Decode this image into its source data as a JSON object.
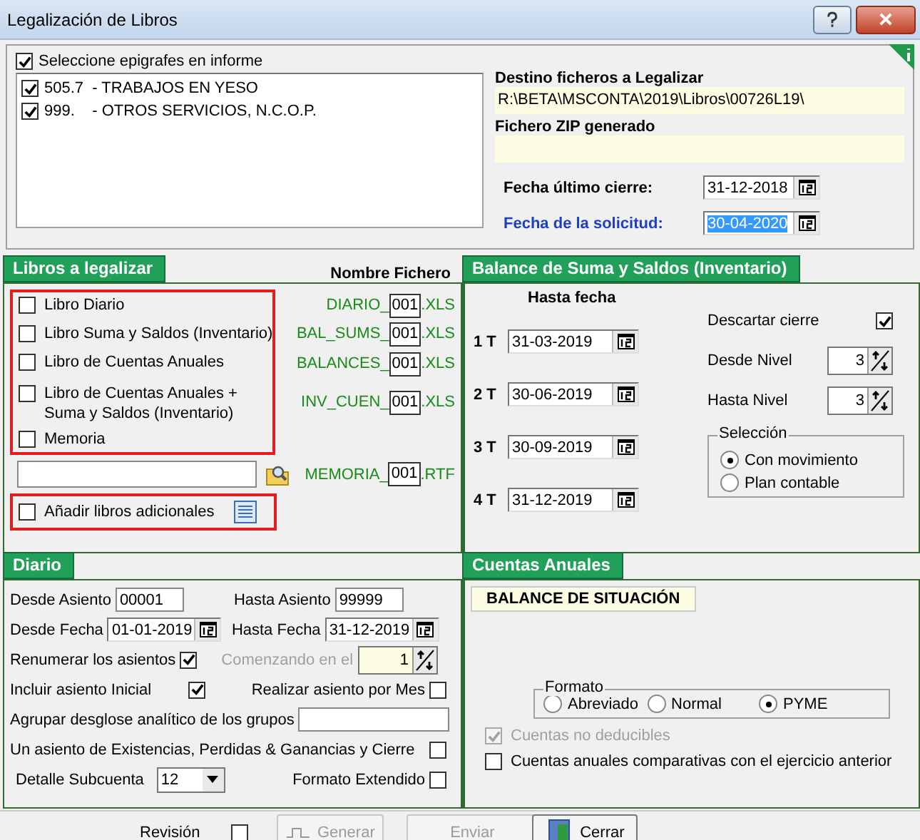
{
  "window": {
    "title": "Legalización de Libros"
  },
  "epigrafes": {
    "header": {
      "label": "Seleccione epigrafes en informe",
      "checked": true
    },
    "items": [
      {
        "label": "505.7  - TRABAJOS EN YESO",
        "checked": true
      },
      {
        "label": "999.    - OTROS SERVICIOS, N.C.O.P.",
        "checked": true
      }
    ]
  },
  "destino": {
    "label": "Destino ficheros a Legalizar",
    "value": "R:\\BETA\\MSCONTA\\2019\\Libros\\00726L19\\"
  },
  "zip": {
    "label": "Fichero ZIP generado"
  },
  "fecha_cierre": {
    "label": "Fecha último cierre:",
    "value": "31-12-2018",
    "selected": false
  },
  "fecha_solicitud": {
    "label": "Fecha de la solicitud:",
    "value": "30-04-2020",
    "selected": true
  },
  "libros": {
    "title": "Libros a legalizar",
    "file_header": "Nombre Fichero",
    "items": [
      {
        "label": "Libro Diario",
        "checked": false,
        "prefix": "DIARIO_",
        "number": "001",
        "ext": ".XLS"
      },
      {
        "label": "Libro Suma y Saldos (Inventario)",
        "checked": false,
        "prefix": "BAL_SUMS_",
        "number": "001",
        "ext": ".XLS"
      },
      {
        "label": "Libro de Cuentas Anuales",
        "checked": false,
        "prefix": "BALANCES_",
        "number": "001",
        "ext": ".XLS"
      },
      {
        "label": "Libro de  Cuentas Anuales + Suma y Saldos (Inventario)",
        "checked": false,
        "prefix": "INV_CUEN_",
        "number": "001",
        "ext": ".XLS"
      },
      {
        "label": "Memoria",
        "checked": false
      }
    ],
    "memoria_file": {
      "prefix": "MEMORIA_",
      "number": "001",
      "ext": ".RTF"
    },
    "adicionales": {
      "label": "Añadir libros adicionales",
      "checked": false
    }
  },
  "balance": {
    "title": "Balance de Suma y Saldos (Inventario)",
    "date_header": "Hasta fecha",
    "quarters": [
      {
        "label": "1 T",
        "value": "31-03-2019"
      },
      {
        "label": "2 T",
        "value": "30-06-2019"
      },
      {
        "label": "3 T",
        "value": "30-09-2019"
      },
      {
        "label": "4 T",
        "value": "31-12-2019"
      }
    ],
    "descartar": {
      "label": "Descartar cierre",
      "checked": true
    },
    "desde_nivel": {
      "label": "Desde Nivel",
      "value": "3"
    },
    "hasta_nivel": {
      "label": "Hasta Nivel",
      "value": "3"
    },
    "seleccion": {
      "title": "Selección",
      "options": [
        {
          "label": "Con movimiento",
          "selected": true
        },
        {
          "label": "Plan contable",
          "selected": false
        }
      ]
    }
  },
  "diario": {
    "title": "Diario",
    "desde_asiento": {
      "label": "Desde Asiento",
      "value": "00001"
    },
    "hasta_asiento": {
      "label": "Hasta Asiento",
      "value": "99999"
    },
    "desde_fecha": {
      "label": "Desde Fecha",
      "value": "01-01-2019"
    },
    "hasta_fecha": {
      "label": "Hasta Fecha",
      "value": "31-12-2019"
    },
    "renumerar": {
      "label": "Renumerar los asientos",
      "checked": true
    },
    "comenzando": {
      "label": "Comenzando en el",
      "value": "1",
      "disabled": true
    },
    "incluir": {
      "label": "Incluir asiento Inicial",
      "checked": true
    },
    "por_mes": {
      "label": "Realizar asiento por Mes",
      "checked": false
    },
    "agrupar": {
      "label": "Agrupar desglose analítico de los grupos"
    },
    "existencias": {
      "label": "Un asiento de Existencias, Perdidas & Ganancias y Cierre",
      "checked": false
    },
    "subcuenta": {
      "label": "Detalle Subcuenta",
      "value": "12"
    },
    "extendido": {
      "label": "Formato Extendido",
      "checked": false
    }
  },
  "cuentas": {
    "title": "Cuentas Anuales",
    "tab": "BALANCE DE SITUACIÓN",
    "formato": {
      "title": "Formato",
      "options": [
        {
          "label": "Abreviado",
          "selected": false
        },
        {
          "label": "Normal",
          "selected": false
        },
        {
          "label": "PYME",
          "selected": true
        }
      ]
    },
    "no_deducibles": {
      "label": "Cuentas no deducibles",
      "checked": true,
      "disabled": true
    },
    "comparativas": {
      "label": "Cuentas anuales comparativas con el ejercicio anterior",
      "checked": false,
      "disabled": false
    }
  },
  "footer": {
    "revision": {
      "label": "Revisión",
      "checked": false
    },
    "buttons": [
      {
        "label": "Generar",
        "disabled": true,
        "kind": "generate"
      },
      {
        "label": "Enviar",
        "disabled": true,
        "kind": "send"
      },
      {
        "label": "Cerrar",
        "disabled": false,
        "kind": "close"
      }
    ]
  }
}
